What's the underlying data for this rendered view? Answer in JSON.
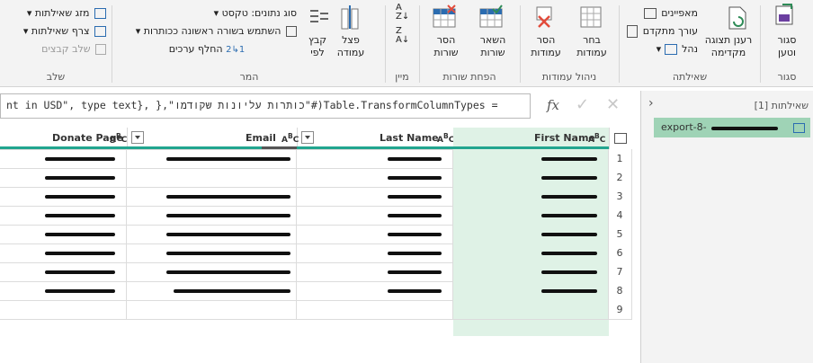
{
  "ribbon": {
    "groups": {
      "close": {
        "label": "סגור",
        "close_load": "סגור\nוטען"
      },
      "query": {
        "label": "שאילתה",
        "refresh": "רענן תצוגה\nמקדימה",
        "properties": "מאפיינים",
        "advanced_editor": "עורך מתקדם",
        "manage": "נהל"
      },
      "manage_columns": {
        "label": "ניהול עמודות",
        "choose_columns": "בחר\nעמודות",
        "remove_columns": "הסר\nעמודות"
      },
      "reduce_rows": {
        "label": "הפחת שורות",
        "keep_rows": "השאר\nשורות",
        "remove_rows": "הסר\nשורות"
      },
      "sort": {
        "label": "מיין"
      },
      "transform": {
        "label": "המר",
        "split_column": "פצל\nעמודה",
        "group_by": "קבץ\nלפי",
        "data_type": "סוג נתונים: טקסט",
        "use_first_row": "השתמש בשורה ראשונה ככותרות",
        "replace_values": "החלף ערכים"
      },
      "combine": {
        "label": "שלב",
        "merge_queries": "מזג שאילתות",
        "append_queries": "צרף שאילתות",
        "combine_files": "שלב קבצים"
      }
    }
  },
  "formula": {
    "text": "Table.TransformColumnTypes(#\"כותרות עליונות שקודמו\",{\"Donate Amount in USD\", type text}, },",
    "visible_text": "nt in USD\", type text}, },\"כותרות עליונות שקודמו\"#)Table.TransformColumnTypes =",
    "fx_label": "fx"
  },
  "table": {
    "columns": [
      {
        "name": "Donate Page",
        "type_icon": "ABC"
      },
      {
        "name": "Email",
        "type_icon": "ABC"
      },
      {
        "name": "Last Name",
        "type_icon": "ABC"
      },
      {
        "name": "First Name",
        "type_icon": "ABC"
      }
    ],
    "row_numbers": [
      "1",
      "2",
      "3",
      "4",
      "5",
      "6",
      "7",
      "8",
      "9"
    ],
    "partial_cells": {
      "r3_first": "n",
      "r6_first": "...",
      "r7_first": "TEST",
      "r7_last": "USD",
      "r8_first": "man",
      "r8_email": "il"
    }
  },
  "queries_pane": {
    "header": "שאילתות [1]",
    "items": [
      {
        "name": "export-8-"
      }
    ]
  },
  "colors": {
    "accent": "#2e8b57",
    "selected_col": "#dff2e6",
    "ribbon_bg": "#f3f3f3"
  }
}
